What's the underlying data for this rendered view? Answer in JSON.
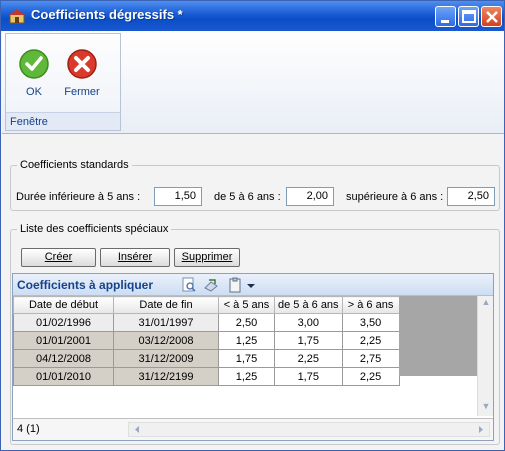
{
  "window": {
    "title": "Coefficients dégressifs *",
    "brand_color": "#1e5fd6"
  },
  "ribbon": {
    "ok_label": "OK",
    "close_label": "Fermer",
    "group_label": "Fenêtre"
  },
  "standards": {
    "legend": "Coefficients standards",
    "lt5_label": "Durée inférieure à 5 ans :",
    "lt5_value": "1,50",
    "5to6_label": "de 5 à 6 ans :",
    "5to6_value": "2,00",
    "gt6_label": "supérieure à 6 ans :",
    "gt6_value": "2,50"
  },
  "special": {
    "legend": "Liste des coefficients spéciaux",
    "create_label": "Créer",
    "insert_label": "Insérer",
    "delete_label": "Supprimer"
  },
  "grid": {
    "title": "Coefficients à appliquer",
    "columns": [
      "Date de début",
      "Date de fin",
      "< à 5 ans",
      "de 5 à 6 ans",
      "> à 6 ans"
    ],
    "rows": [
      [
        "01/02/1996",
        "31/01/1997",
        "2,50",
        "3,00",
        "3,50"
      ],
      [
        "01/01/2001",
        "03/12/2008",
        "1,25",
        "1,75",
        "2,25"
      ],
      [
        "04/12/2008",
        "31/12/2009",
        "1,75",
        "2,25",
        "2,75"
      ],
      [
        "01/01/2010",
        "31/12/2199",
        "1,25",
        "1,75",
        "2,25"
      ]
    ],
    "count_label": "4 (1)"
  }
}
